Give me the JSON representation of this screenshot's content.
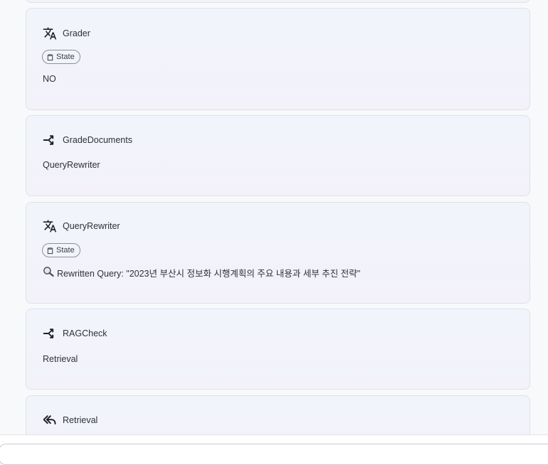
{
  "cards": [
    {
      "title": "Grader",
      "icon": "translate-icon",
      "state_label": "State",
      "body": "NO"
    },
    {
      "title": "GradeDocuments",
      "icon": "route-split-icon",
      "body": "QueryRewriter"
    },
    {
      "title": "QueryRewriter",
      "icon": "translate-icon",
      "state_label": "State",
      "body_icon": "magnifier-icon",
      "body": "Rewritten Query: \"2023년 부산시 정보화 시행계획의 주요 내용과 세부 추진 전략\""
    },
    {
      "title": "RAGCheck",
      "icon": "route-split-icon",
      "body": "Retrieval"
    },
    {
      "title": "Retrieval",
      "icon": "reply-all-icon"
    }
  ],
  "colors": {
    "card_border": "#dfe1e8",
    "card_bg_top": "#f1f5fb",
    "card_bg_bottom": "#f3f2fa",
    "text": "#2e3038"
  }
}
